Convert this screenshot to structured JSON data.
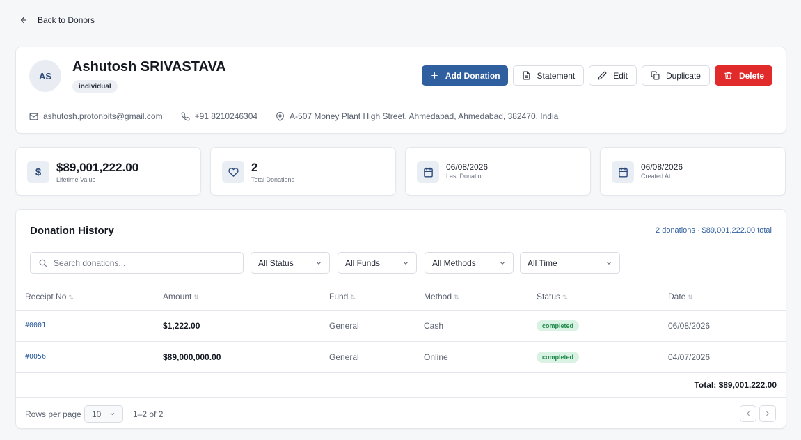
{
  "nav": {
    "back_label": "Back to Donors"
  },
  "donor": {
    "initials": "AS",
    "name": "Ashutosh SRIVASTAVA",
    "type": "individual",
    "email": "ashutosh.protonbits@gmail.com",
    "phone": "+91 8210246304",
    "address": "A-507 Money Plant High Street, Ahmedabad, Ahmedabad, 382470, India"
  },
  "actions": {
    "add_donation": "Add Donation",
    "statement": "Statement",
    "edit": "Edit",
    "duplicate": "Duplicate",
    "delete": "Delete"
  },
  "stats": [
    {
      "value": "$89,001,222.00",
      "label": "Lifetime Value",
      "icon": "dollar-icon"
    },
    {
      "value": "2",
      "label": "Total Donations",
      "icon": "heart-icon"
    },
    {
      "value": "06/08/2026",
      "label": "Last Donation",
      "icon": "calendar-icon"
    },
    {
      "value": "06/08/2026",
      "label": "Created At",
      "icon": "calendar-icon"
    }
  ],
  "history": {
    "title": "Donation History",
    "summary": "2 donations · $89,001,222.00 total",
    "search_placeholder": "Search donations...",
    "filters": {
      "status": "All Status",
      "funds": "All Funds",
      "methods": "All Methods",
      "time": "All Time"
    },
    "columns": [
      "Receipt No",
      "Amount",
      "Fund",
      "Method",
      "Status",
      "Date"
    ],
    "rows": [
      {
        "receipt": "#0001",
        "amount": "$1,222.00",
        "fund": "General",
        "method": "Cash",
        "status": "completed",
        "date": "06/08/2026"
      },
      {
        "receipt": "#0056",
        "amount": "$89,000,000.00",
        "fund": "General",
        "method": "Online",
        "status": "completed",
        "date": "04/07/2026"
      }
    ],
    "total": "Total: $89,001,222.00",
    "pagination": {
      "rows_per_page_label": "Rows per page",
      "rows_per_page": "10",
      "range": "1–2 of 2"
    }
  },
  "colors": {
    "primary": "#2f5f9e",
    "danger": "#e12b2b",
    "success_bg": "#d9f2e3",
    "success_text": "#1f8a4c"
  }
}
